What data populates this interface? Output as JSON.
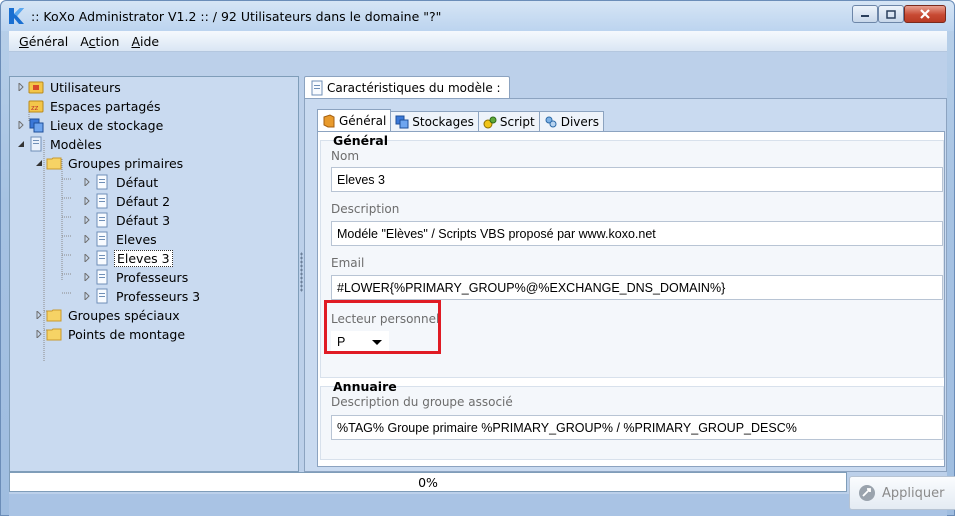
{
  "window": {
    "title": ":: KoXo Administrator V1.2 :: / 92 Utilisateurs dans le domaine \"?\""
  },
  "menu": {
    "items": [
      {
        "prefix": "",
        "underlined": "G",
        "rest": "énéral"
      },
      {
        "prefix": "A",
        "underlined": "c",
        "rest": "tion"
      },
      {
        "prefix": "",
        "underlined": "A",
        "rest": "ide"
      }
    ]
  },
  "tree": {
    "items": [
      {
        "label": "Utilisateurs",
        "icon": "users-folder-icon"
      },
      {
        "label": "Espaces partagés",
        "icon": "shared-space-icon"
      },
      {
        "label": "Lieux de stockage",
        "icon": "storage-icon"
      },
      {
        "label": "Modèles",
        "icon": "model-icon"
      },
      {
        "label": "Groupes primaires",
        "icon": "folder-icon"
      },
      {
        "label": "Défaut",
        "icon": "document-icon"
      },
      {
        "label": "Défaut 2",
        "icon": "document-icon"
      },
      {
        "label": "Défaut 3",
        "icon": "document-icon"
      },
      {
        "label": "Eleves",
        "icon": "document-icon"
      },
      {
        "label": "Eleves 3",
        "icon": "document-icon",
        "selected": true
      },
      {
        "label": "Professeurs",
        "icon": "document-icon"
      },
      {
        "label": "Professeurs 3",
        "icon": "document-icon"
      },
      {
        "label": "Groupes spéciaux",
        "icon": "folder-icon"
      },
      {
        "label": "Points de montage",
        "icon": "folder-icon"
      }
    ]
  },
  "panel": {
    "title": "Caractéristiques du modèle :",
    "tabs": [
      {
        "label": "Général",
        "icon": "general-tab-icon",
        "active": true
      },
      {
        "label": "Stockages",
        "icon": "storage-tab-icon"
      },
      {
        "label": "Script",
        "icon": "script-tab-icon"
      },
      {
        "label": "Divers",
        "icon": "misc-tab-icon"
      }
    ]
  },
  "general": {
    "section_title": "Général",
    "name_label": "Nom",
    "name_value": "Eleves 3",
    "description_label": "Description",
    "description_value": "Modéle \"Elèves\" / Scripts VBS proposé par www.koxo.net",
    "email_label": "Email",
    "email_value": "#LOWER{%PRIMARY_GROUP%@%EXCHANGE_DNS_DOMAIN%}",
    "drive_label": "Lecteur personnel",
    "drive_value": "P"
  },
  "directory": {
    "section_title": "Annuaire",
    "group_desc_label": "Description du groupe associé",
    "group_desc_value": "%TAG% Groupe primaire %PRIMARY_GROUP% / %PRIMARY_GROUP_DESC%"
  },
  "status": {
    "progress_text": "0%",
    "progress": 0,
    "apply_label": "Appliquer"
  },
  "colors": {
    "highlight": "#e01b24",
    "panel_bg": "#c9daf0",
    "frame_bg": "#bcd0ea"
  }
}
